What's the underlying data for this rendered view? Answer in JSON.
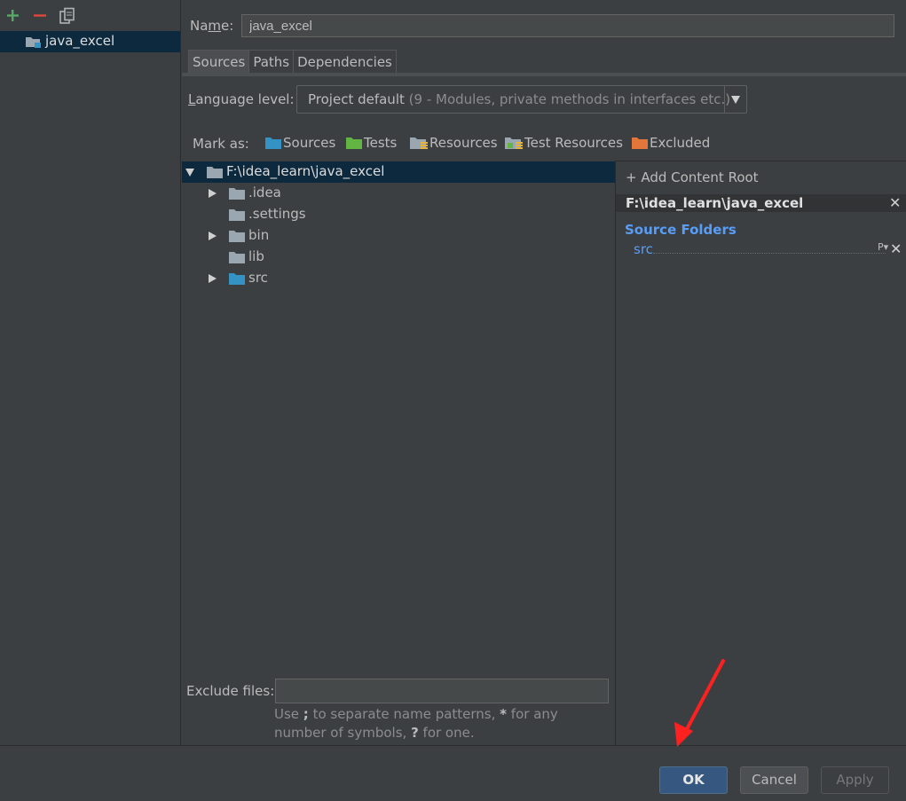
{
  "toolbar": {
    "add_icon": "plus-icon",
    "remove_icon": "minus-icon",
    "copy_icon": "copy-icon"
  },
  "modules": [
    {
      "label": "java_excel",
      "icon": "module-folder-icon"
    }
  ],
  "name_field": {
    "label": "Name:",
    "value": "java_excel"
  },
  "tabs": [
    {
      "label": "Sources",
      "selected": true
    },
    {
      "label": "Paths"
    },
    {
      "label": "Dependencies"
    }
  ],
  "language_level": {
    "label": "Language level:",
    "value": "Project default",
    "hint": "(9 - Modules, private methods in interfaces etc.)"
  },
  "mark_as": {
    "label": "Mark as:",
    "items": [
      {
        "label": "Sources",
        "icon": "sources-folder-icon",
        "color": "#3592c4"
      },
      {
        "label": "Tests",
        "icon": "tests-folder-icon",
        "color": "#62b543"
      },
      {
        "label": "Resources",
        "icon": "resources-folder-icon",
        "color": "#9aa7b0"
      },
      {
        "label": "Test Resources",
        "icon": "test-resources-folder-icon",
        "color": "#9aa7b0"
      },
      {
        "label": "Excluded",
        "icon": "excluded-folder-icon",
        "color": "#e2763b"
      }
    ]
  },
  "tree": [
    {
      "label": "F:\\idea_learn\\java_excel",
      "expanded": true,
      "selected": true
    },
    {
      "label": ".idea",
      "expandable": true
    },
    {
      "label": ".settings"
    },
    {
      "label": "bin",
      "expandable": true
    },
    {
      "label": "lib"
    },
    {
      "label": "src",
      "expandable": true,
      "source": true
    }
  ],
  "content_root": {
    "add_label": "+ Add Content Root",
    "path": "F:\\idea_learn\\java_excel",
    "source_folders_title": "Source Folders",
    "source_folders": [
      "src"
    ],
    "prop_label": "P"
  },
  "exclude": {
    "label": "Exclude files:",
    "value": "",
    "hint": "Use ; to separate name patterns, * for any number of symbols, ? for one."
  },
  "buttons": {
    "ok": "OK",
    "cancel": "Cancel",
    "apply": "Apply"
  },
  "colors": {
    "background": "#3c3f41",
    "selection": "#0d293e",
    "link_blue": "#589df6",
    "annotation_red": "#ff2020"
  }
}
